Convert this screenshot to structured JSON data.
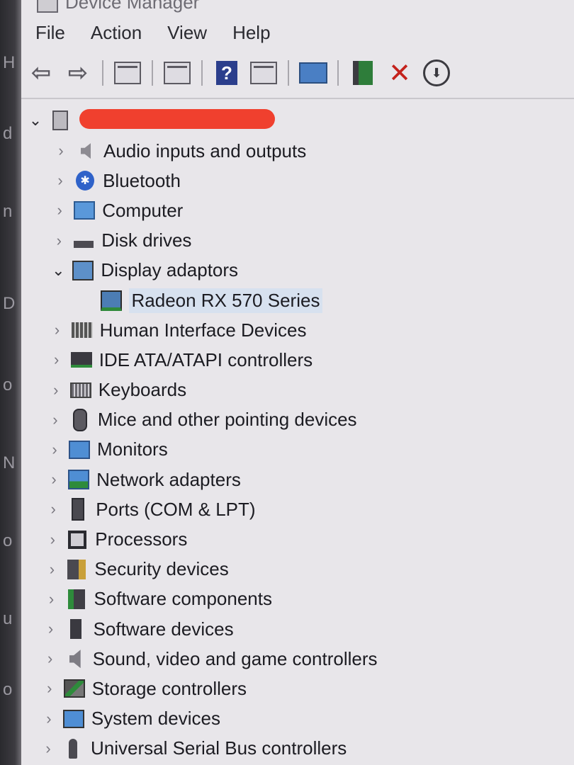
{
  "window": {
    "title": "Device Manager"
  },
  "left_strip_glyphs": [
    "H",
    "d",
    "n",
    "D",
    "o",
    "N",
    "o",
    "u",
    "o"
  ],
  "menu": [
    "File",
    "Action",
    "View",
    "Help"
  ],
  "toolbar": {
    "icons": [
      "back-arrow-icon",
      "forward-arrow-icon",
      "properties-icon",
      "list-icon",
      "help-icon",
      "view-icon",
      "monitor-icon",
      "update-driver-icon",
      "uninstall-icon",
      "download-icon"
    ]
  },
  "tree": {
    "categories": [
      {
        "label": "Audio inputs and outputs",
        "icon": "speaker-icon",
        "expanded": false
      },
      {
        "label": "Bluetooth",
        "icon": "bluetooth-icon",
        "expanded": false
      },
      {
        "label": "Computer",
        "icon": "computer-icon",
        "expanded": false
      },
      {
        "label": "Disk drives",
        "icon": "disk-drive-icon",
        "expanded": false
      },
      {
        "label": "Display adaptors",
        "icon": "display-adapter-icon",
        "expanded": true,
        "children": [
          {
            "label": "Radeon RX 570 Series",
            "icon": "graphics-card-icon",
            "selected": true
          }
        ]
      },
      {
        "label": "Human Interface Devices",
        "icon": "hid-icon",
        "expanded": false
      },
      {
        "label": "IDE ATA/ATAPI controllers",
        "icon": "ide-controller-icon",
        "expanded": false
      },
      {
        "label": "Keyboards",
        "icon": "keyboard-icon",
        "expanded": false
      },
      {
        "label": "Mice and other pointing devices",
        "icon": "mouse-icon",
        "expanded": false
      },
      {
        "label": "Monitors",
        "icon": "monitor-icon",
        "expanded": false
      },
      {
        "label": "Network adapters",
        "icon": "network-adapter-icon",
        "expanded": false
      },
      {
        "label": "Ports (COM & LPT)",
        "icon": "port-icon",
        "expanded": false
      },
      {
        "label": "Processors",
        "icon": "processor-icon",
        "expanded": false
      },
      {
        "label": "Security devices",
        "icon": "security-device-icon",
        "expanded": false
      },
      {
        "label": "Software components",
        "icon": "software-component-icon",
        "expanded": false
      },
      {
        "label": "Software devices",
        "icon": "software-device-icon",
        "expanded": false
      },
      {
        "label": "Sound, video and game controllers",
        "icon": "sound-controller-icon",
        "expanded": false
      },
      {
        "label": "Storage controllers",
        "icon": "storage-controller-icon",
        "expanded": false
      },
      {
        "label": "System devices",
        "icon": "system-device-icon",
        "expanded": false
      },
      {
        "label": "Universal Serial Bus controllers",
        "icon": "usb-controller-icon",
        "expanded": false
      }
    ]
  },
  "colors": {
    "redaction": "#f0402e",
    "selection": "#d7e1ef",
    "background": "#e8e6ea"
  }
}
